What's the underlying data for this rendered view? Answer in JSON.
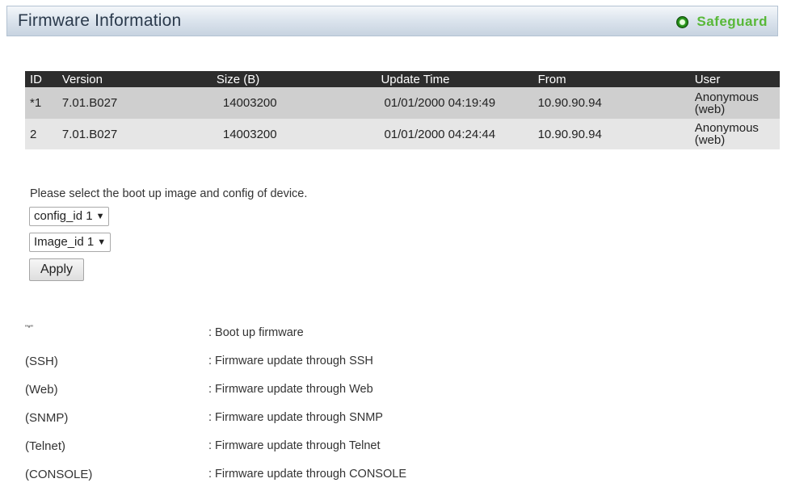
{
  "header": {
    "title": "Firmware Information",
    "safeguard_label": "Safeguard"
  },
  "table": {
    "columns": [
      "ID",
      "Version",
      "Size (B)",
      "Update Time",
      "From",
      "User"
    ],
    "rows": [
      {
        "id": "*1",
        "version": "7.01.B027",
        "size": "14003200",
        "update_time": "01/01/2000 04:19:49",
        "from": "10.90.90.94",
        "user": "Anonymous (web)"
      },
      {
        "id": "2",
        "version": "7.01.B027",
        "size": "14003200",
        "update_time": "01/01/2000 04:24:44",
        "from": "10.90.90.94",
        "user": "Anonymous (web)"
      }
    ]
  },
  "boot": {
    "instruction": "Please select the boot up image and config of device.",
    "config_select": "config_id 1",
    "image_select": "Image_id 1",
    "apply_label": "Apply"
  },
  "legend": [
    {
      "key": "\"*\"",
      "desc": ": Boot up firmware"
    },
    {
      "key": "(SSH)",
      "desc": ": Firmware update through SSH"
    },
    {
      "key": "(Web)",
      "desc": ": Firmware update through Web"
    },
    {
      "key": "(SNMP)",
      "desc": ": Firmware update through SNMP"
    },
    {
      "key": "(Telnet)",
      "desc": ": Firmware update through Telnet"
    },
    {
      "key": "(CONSOLE)",
      "desc": ": Firmware update through CONSOLE"
    }
  ],
  "colors": {
    "header_bar": "#dde5ee",
    "table_header": "#2d2d2d",
    "row_odd": "#cfcfcf",
    "row_even": "#e6e6e6",
    "safeguard": "#58b838"
  }
}
